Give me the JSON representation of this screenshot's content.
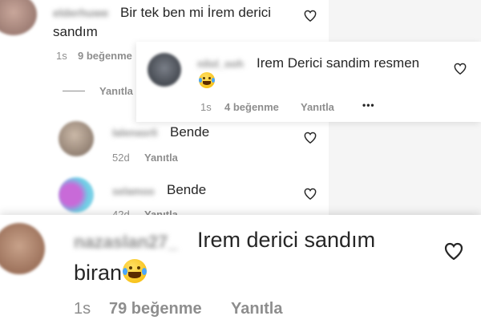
{
  "comments": [
    {
      "username": "elderhuwe",
      "text_line1": "Bir tek ben mi İrem derici",
      "text_line2": "sandım",
      "time": "1s",
      "likes": "9 beğenme"
    },
    {
      "username": "nilol_ooh",
      "text_line1": "Irem Derici sandim resmen",
      "time": "1s",
      "likes": "4 beğenme",
      "reply": "Yanıtla",
      "more": "•••"
    },
    {
      "username": "lalenasrli",
      "text": "Bende",
      "time": "52d",
      "reply": "Yanıtla"
    },
    {
      "username": "selamoo",
      "text": "Bende",
      "time": "42d",
      "reply": "Yanıtla"
    },
    {
      "username": "nazaslan27_",
      "text_line1": "Irem derici sandım",
      "text_line2": "biran",
      "time": "1s",
      "likes": "79 beğenme",
      "reply": "Yanıtla"
    }
  ],
  "replies_toggle": "Yanıtla",
  "colors": {
    "text": "#262626",
    "meta": "#8e8e8e",
    "background": "#ffffff"
  },
  "icons": [
    "heart-icon",
    "more-options-icon",
    "laughing-tears-emoji"
  ]
}
